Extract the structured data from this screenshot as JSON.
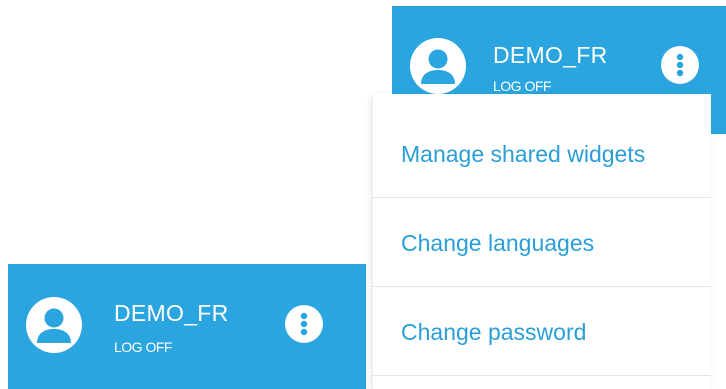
{
  "top_header": {
    "username": "DEMO_FR",
    "logoff_label": "LOG OFF",
    "avatar_icon": "user-icon",
    "menu_icon": "more-vertical-icon"
  },
  "menu": {
    "items": [
      {
        "label": "Manage shared widgets"
      },
      {
        "label": "Change languages"
      },
      {
        "label": "Change password"
      }
    ]
  },
  "bottom_header": {
    "username": "DEMO_FR",
    "logoff_label": "LOG OFF",
    "avatar_icon": "user-icon",
    "menu_icon": "more-vertical-icon"
  },
  "colors": {
    "header_bg": "#2aa5df",
    "menu_text": "#2a9ed8",
    "divider": "#e3e3e3"
  }
}
